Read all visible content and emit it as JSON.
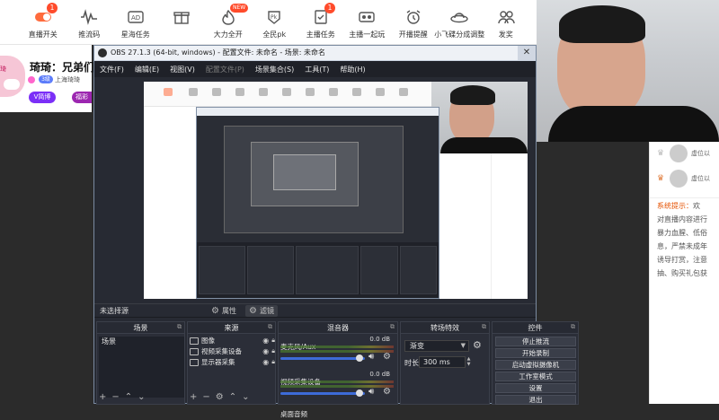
{
  "toolbar": {
    "items": [
      {
        "label": "直播开关",
        "icon": "live-toggle-icon",
        "badge": "1"
      },
      {
        "label": "推流码",
        "icon": "waveform-icon",
        "badge": ""
      },
      {
        "label": "星海任务",
        "icon": "ad-icon",
        "badge": ""
      },
      {
        "label": "",
        "icon": "gift-icon",
        "badge": ""
      },
      {
        "label": "大力全开",
        "icon": "flame-icon",
        "badge": "NEW"
      },
      {
        "label": "全民pk",
        "icon": "pk-icon",
        "badge": ""
      },
      {
        "label": "主播任务",
        "icon": "task-check-icon",
        "badge": "1"
      },
      {
        "label": "主播一起玩",
        "icon": "play-together-icon",
        "badge": ""
      },
      {
        "label": "开播提醒",
        "icon": "alarm-clock-icon",
        "badge": ""
      },
      {
        "label": "小飞碟分成调整",
        "icon": "ufo-icon",
        "badge": ""
      },
      {
        "label": "发奖",
        "icon": "users-icon",
        "badge": ""
      }
    ]
  },
  "profile": {
    "avatar_tag": "琦",
    "name": "琦琦：兄弟们",
    "level": "3级",
    "location": "上海琦琦",
    "vip_label": "V简博",
    "second_label": "福彩"
  },
  "chat": {
    "rows": [
      {
        "name": "虚位以"
      },
      {
        "name": "虚位以"
      }
    ],
    "notice_lines": [
      {
        "tip": "系统提示：",
        "text": "欢"
      },
      {
        "tip": "",
        "text": "对直播内容进行"
      },
      {
        "tip": "",
        "text": "暴力血腥、低俗"
      },
      {
        "tip": "",
        "text": "息，严禁未成年"
      },
      {
        "tip": "",
        "text": "诱导打赏，注意"
      },
      {
        "tip": "",
        "text": "抽、购买礼包获"
      }
    ]
  },
  "obs": {
    "title": "OBS 27.1.3 (64-bit, windows) - 配置文件: 未命名 - 场景: 未命名",
    "close": "✕",
    "menu": [
      "文件(F)",
      "编辑(E)",
      "视图(V)",
      "配置文件(P)",
      "场景集合(S)",
      "工具(T)",
      "帮助(H)"
    ],
    "no_source": "未选择源",
    "properties": "属性",
    "filters": "滤镜",
    "docks": {
      "scenes": {
        "title": "场景",
        "items": [
          "场景"
        ],
        "footer": [
          "+",
          "−",
          "⌃",
          "⌄"
        ]
      },
      "sources": {
        "title": "来源",
        "items": [
          {
            "name": "图像"
          },
          {
            "name": "视频采集设备"
          },
          {
            "name": "显示器采集"
          }
        ],
        "footer": [
          "+",
          "−",
          "⚙",
          "⌃",
          "⌄"
        ]
      },
      "mixer": {
        "title": "混音器",
        "channels": [
          {
            "name": "麦克风/Aux",
            "db": "0.0 dB",
            "level": 0.9
          },
          {
            "name": "视频采集设备",
            "db": "0.0 dB",
            "level": 0.9
          },
          {
            "name": "桌面音频",
            "db": "",
            "level": 0.9
          }
        ]
      },
      "transitions": {
        "title": "转场特效",
        "type": "渐变",
        "duration_label": "时长",
        "duration_value": "300 ms"
      },
      "controls": {
        "title": "控件",
        "buttons": [
          "停止推流",
          "开始录制",
          "启动虚拟摄像机",
          "工作室模式",
          "设置",
          "退出"
        ]
      }
    }
  }
}
